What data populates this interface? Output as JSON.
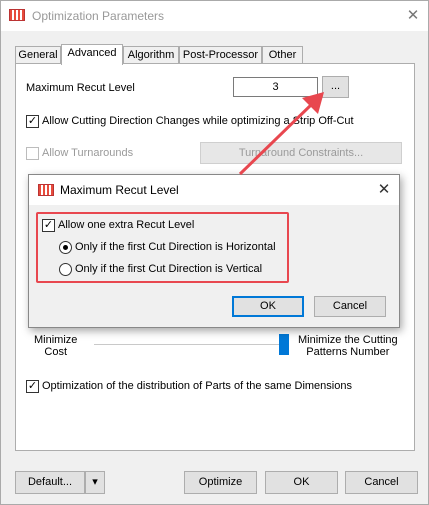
{
  "window": {
    "title": "Optimization Parameters",
    "close_glyph": "✕"
  },
  "tabs": [
    {
      "label": "General"
    },
    {
      "label": "Advanced",
      "active": true
    },
    {
      "label": "Algorithm"
    },
    {
      "label": "Post-Processor"
    },
    {
      "label": "Other"
    }
  ],
  "advanced": {
    "max_recut_label": "Maximum Recut Level",
    "max_recut_value": "3",
    "browse_label": "...",
    "allow_cutting_dir_label": "Allow Cutting Direction Changes while optimizing a Strip Off-Cut",
    "allow_cutting_dir_checked": true,
    "allow_turnarounds_label": "Allow Turnarounds",
    "allow_turnarounds_checked": false,
    "turnaround_constraints_label": "Turnaround Constraints...",
    "slider_left_label": "Minimize\nCost",
    "slider_right_label": "Minimize the Cutting\nPatterns Number",
    "slider_value_fraction": 1.0,
    "optimization_distribution_label": "Optimization of the distribution of Parts of the same Dimensions",
    "optimization_distribution_checked": true
  },
  "footer": {
    "default_label": "Default...",
    "default_dropdown_glyph": "▾",
    "optimize_label": "Optimize",
    "ok_label": "OK",
    "cancel_label": "Cancel"
  },
  "dialog": {
    "title": "Maximum Recut Level",
    "close_glyph": "✕",
    "allow_extra_label": "Allow one extra Recut Level",
    "allow_extra_checked": true,
    "option_horizontal_label": "Only if the first Cut Direction is Horizontal",
    "option_horizontal_selected": true,
    "option_vertical_label": "Only if the first Cut Direction is Vertical",
    "option_vertical_selected": false,
    "ok_label": "OK",
    "cancel_label": "Cancel"
  },
  "colors": {
    "accent": "#0078d7",
    "highlight": "#e8474f"
  },
  "icons": {
    "app": "app-grid-icon",
    "arrow": "red-callout-arrow-icon"
  }
}
